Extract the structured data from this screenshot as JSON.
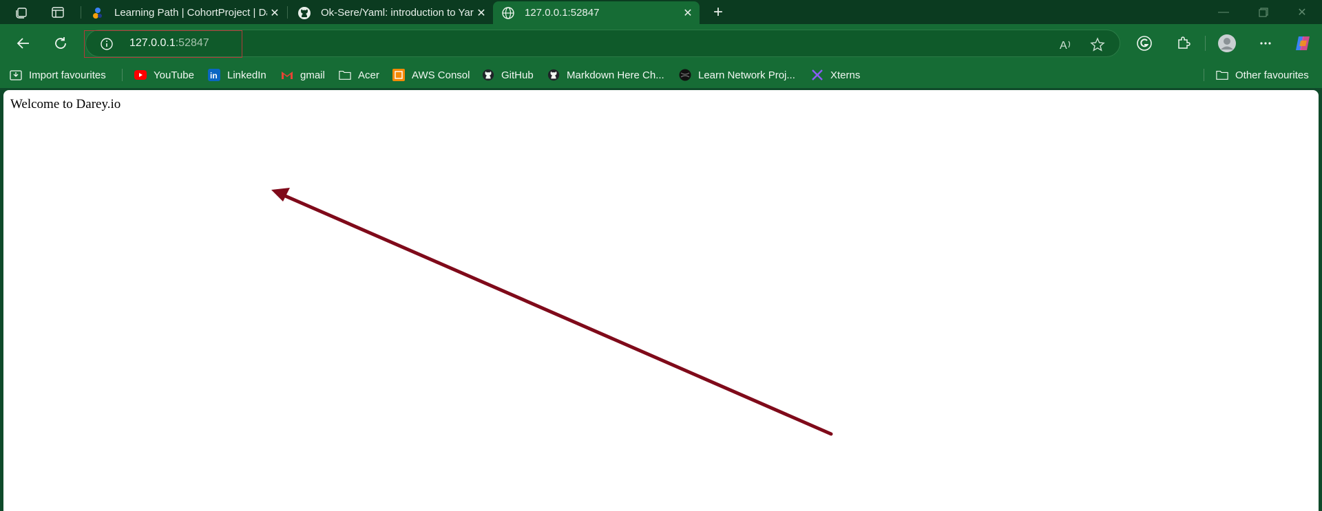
{
  "tabs": [
    {
      "title": "Learning Path | CohortProject | Da",
      "favicon": "darey-icon"
    },
    {
      "title": "Ok-Sere/Yaml: introduction to Yar",
      "favicon": "github-icon"
    },
    {
      "title": "127.0.0.1:52847",
      "favicon": "globe-icon",
      "active": true
    }
  ],
  "address_bar": {
    "host": "127.0.0.1",
    "port": ":52847"
  },
  "bookmarks": [
    {
      "label": "Import favourites",
      "icon": "import-icon"
    },
    {
      "label": "YouTube",
      "icon": "youtube-icon"
    },
    {
      "label": "LinkedIn",
      "icon": "linkedin-icon"
    },
    {
      "label": "gmail",
      "icon": "gmail-icon"
    },
    {
      "label": "Acer",
      "icon": "folder-icon"
    },
    {
      "label": "AWS Consol",
      "icon": "aws-icon"
    },
    {
      "label": "GitHub",
      "icon": "github-icon"
    },
    {
      "label": "Markdown Here Ch...",
      "icon": "github-icon"
    },
    {
      "label": "Learn Network Proj...",
      "icon": "network-icon"
    },
    {
      "label": "Xterns",
      "icon": "xterns-icon"
    }
  ],
  "other_favourites": "Other favourites",
  "page": {
    "text": "Welcome to Darey.io"
  },
  "colors": {
    "frame": "#166c35",
    "tabstrip": "#0b3b20",
    "annotation_arrow": "#7f0a1a"
  }
}
